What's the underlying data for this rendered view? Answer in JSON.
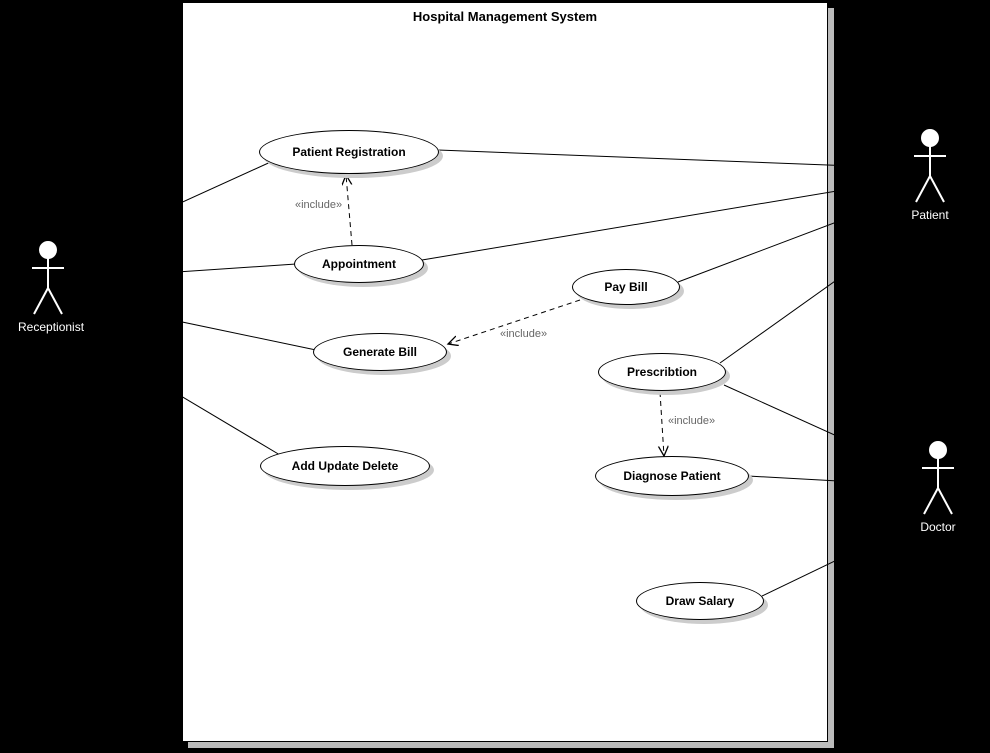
{
  "system": {
    "title": "Hospital Management System"
  },
  "actors": {
    "receptionist": {
      "label": "Receptionist"
    },
    "patient": {
      "label": "Patient"
    },
    "doctor": {
      "label": "Doctor"
    }
  },
  "usecases": {
    "patient_registration": {
      "label": "Patient Registration"
    },
    "appointment": {
      "label": "Appointment"
    },
    "pay_bill": {
      "label": "Pay Bill"
    },
    "generate_bill": {
      "label": "Generate Bill"
    },
    "prescription": {
      "label": "Prescribtion"
    },
    "add_update_delete": {
      "label": "Add Update Delete"
    },
    "diagnose_patient": {
      "label": "Diagnose Patient"
    },
    "draw_salary": {
      "label": "Draw Salary"
    }
  },
  "relations": {
    "include1": {
      "label": "«include»"
    },
    "include2": {
      "label": "«include»"
    },
    "include3": {
      "label": "«include»"
    }
  }
}
